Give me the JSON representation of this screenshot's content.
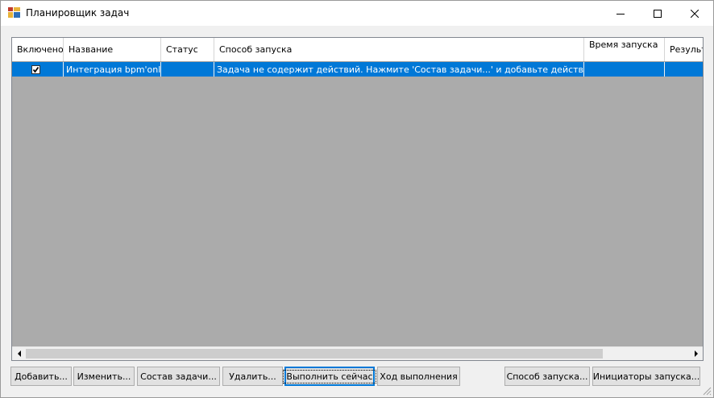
{
  "window": {
    "title": "Планировщик задач"
  },
  "grid": {
    "columns": [
      "Включено",
      "Название",
      "Статус",
      "Способ запуска",
      "Время запуска",
      "Результат"
    ],
    "rows": [
      {
        "enabled": true,
        "name": "Интеграция bpm'online",
        "status": "",
        "launch_method": "Задача не содержит действий. Нажмите 'Состав задачи...' и добавьте действия в задачу",
        "launch_time": "",
        "result": ""
      }
    ]
  },
  "buttons": {
    "add": "Добавить...",
    "edit": "Изменить...",
    "composition": "Состав задачи...",
    "delete": "Удалить...",
    "run_now": "Выполнить сейчас",
    "progress": "Ход выполнения",
    "launch_method": "Способ запуска...",
    "initiators": "Инициаторы запуска..."
  },
  "colors": {
    "selection": "#0078d7",
    "grid_background": "#ababab"
  }
}
